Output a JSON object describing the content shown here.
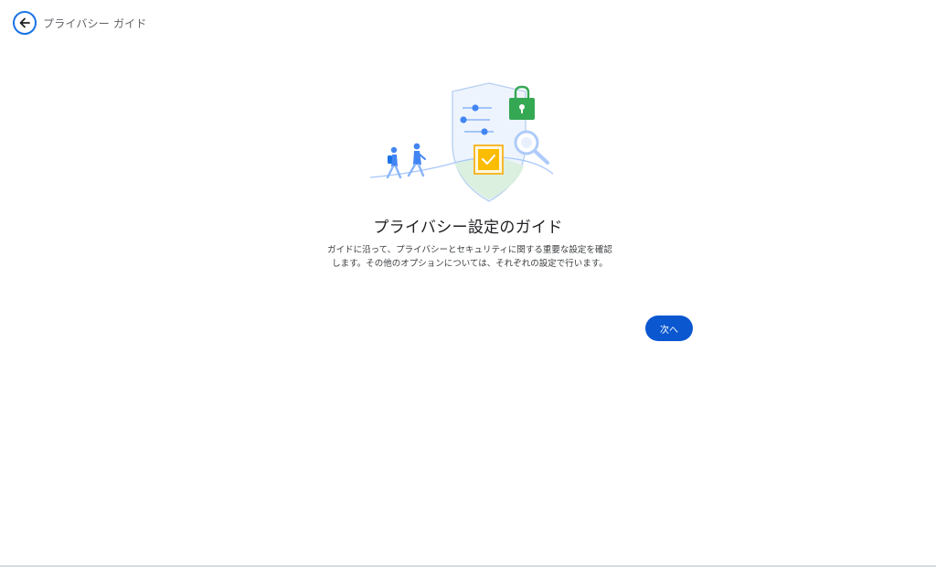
{
  "header": {
    "back_icon": "arrow-back-icon",
    "title": "プライバシー ガイド"
  },
  "main": {
    "illustration_icon": "privacy-shield-illustration",
    "title": "プライバシー設定のガイド",
    "description": "ガイドに沿って、プライバシーとセキュリティに関する重要な設定を確認します。その他のオプションについては、それぞれの設定で行います。",
    "next_label": "次へ"
  },
  "colors": {
    "accent": "#0b57d0",
    "back_ring": "#1a73e8",
    "lock": "#34a853",
    "checkbox": "#fbbc04"
  }
}
